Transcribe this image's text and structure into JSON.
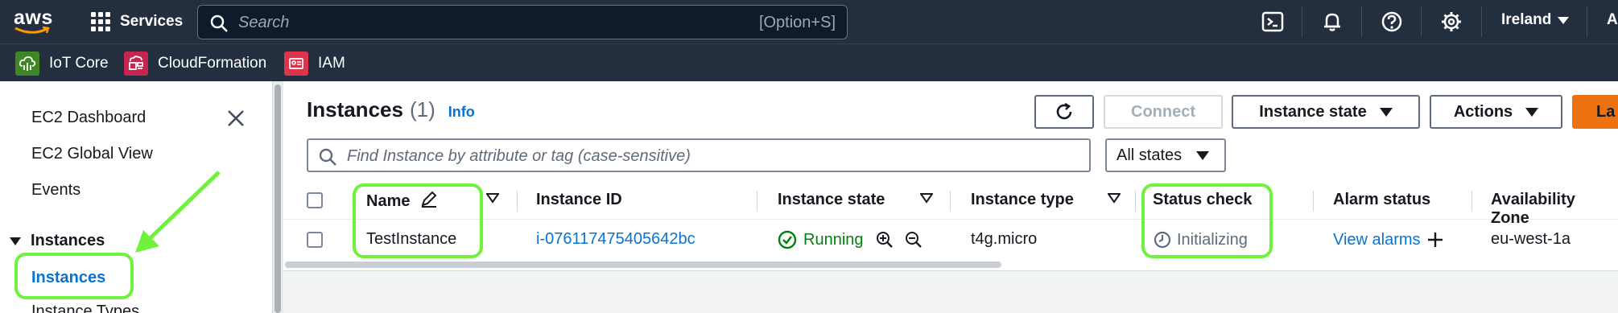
{
  "topnav": {
    "logo_text": "aws",
    "services_label": "Services",
    "search_placeholder": "Search",
    "search_shortcut": "[Option+S]",
    "region_label": "Ireland",
    "account_label_cut": "A"
  },
  "favorites": [
    {
      "label": "IoT Core",
      "color": "#3f8624"
    },
    {
      "label": "CloudFormation",
      "color": "#c7244f"
    },
    {
      "label": "IAM",
      "color": "#dd344c"
    }
  ],
  "sidebar": {
    "items": [
      "EC2 Dashboard",
      "EC2 Global View",
      "Events"
    ],
    "section_label": "Instances",
    "active_item": "Instances",
    "next_item_cut": "Instance Types"
  },
  "main": {
    "title": "Instances",
    "count": "(1)",
    "info": "Info",
    "buttons": {
      "connect": "Connect",
      "instance_state": "Instance state",
      "actions": "Actions",
      "launch": "La"
    },
    "filter_placeholder": "Find Instance by attribute or tag (case-sensitive)",
    "states_filter": "All states",
    "columns": [
      "Name",
      "Instance ID",
      "Instance state",
      "Instance type",
      "Status check",
      "Alarm status",
      "Availability Zone"
    ],
    "row": {
      "name": "TestInstance",
      "instance_id": "i-076117475405642bc",
      "state": "Running",
      "type": "t4g.micro",
      "status_check": "Initializing",
      "alarm": "View alarms",
      "az": "eu-west-1a"
    }
  },
  "colors": {
    "nav_bg": "#232f3e",
    "link": "#0972d3",
    "running": "#037f0c",
    "launch": "#ec7211",
    "annotation": "#6ef23b"
  }
}
